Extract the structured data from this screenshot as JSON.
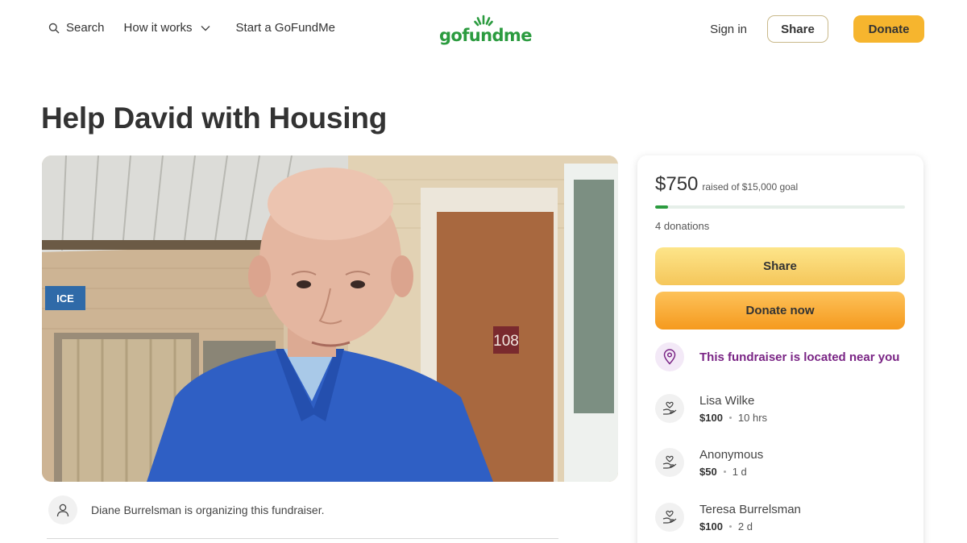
{
  "header": {
    "search_label": "Search",
    "how_it_works_label": "How it works",
    "start_label": "Start a GoFundMe",
    "logo_text": "gofundme",
    "signin_label": "Sign in",
    "share_label": "Share",
    "donate_label": "Donate"
  },
  "campaign": {
    "title": "Help David with Housing",
    "organizer_text": "Diane Burrelsman is organizing this fundraiser."
  },
  "card": {
    "raised_amount": "$750",
    "raised_goal": "raised of $15,000 goal",
    "progress_fraction": 0.05,
    "donations_count": "4 donations",
    "share_label": "Share",
    "donate_label": "Donate now",
    "location_text": "This fundraiser is located near you",
    "donors": [
      {
        "name": "Lisa Wilke",
        "amount": "$100",
        "time": "10 hrs"
      },
      {
        "name": "Anonymous",
        "amount": "$50",
        "time": "1 d"
      },
      {
        "name": "Teresa Burrelsman",
        "amount": "$100",
        "time": "2 d"
      }
    ]
  },
  "photo": {
    "sign_text": "ICE",
    "door_number": "108"
  },
  "colors": {
    "brand_green": "#2b9b3f",
    "donate_orange": "#f6b52e",
    "location_purple": "#7a2585"
  }
}
